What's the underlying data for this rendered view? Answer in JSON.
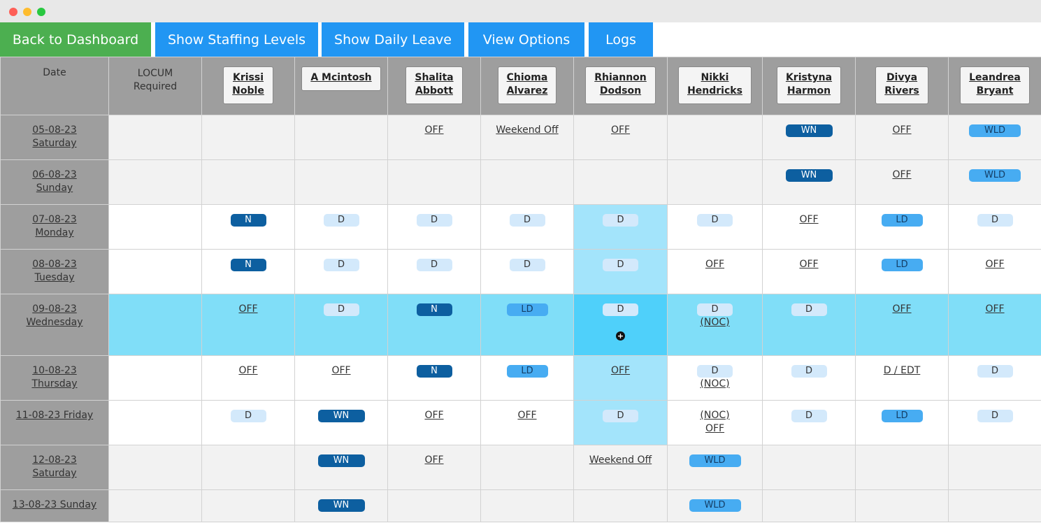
{
  "toolbar": {
    "back": "Back to Dashboard",
    "staffing": "Show Staffing Levels",
    "leave": "Show Daily Leave",
    "options": "View Options",
    "logs": "Logs"
  },
  "header": {
    "date": "Date",
    "locum_line1": "LOCUM",
    "locum_line2": "Required"
  },
  "staff": [
    {
      "first": "Krissi",
      "last": "Noble"
    },
    {
      "first": "A Mcintosh",
      "last": ""
    },
    {
      "first": "Shalita",
      "last": "Abbott"
    },
    {
      "first": "Chioma",
      "last": "Alvarez"
    },
    {
      "first": "Rhiannon",
      "last": "Dodson"
    },
    {
      "first": "Nikki",
      "last": "Hendricks"
    },
    {
      "first": "Kristyna",
      "last": "Harmon"
    },
    {
      "first": "Divya",
      "last": "Rivers"
    },
    {
      "first": "Leandrea",
      "last": "Bryant"
    }
  ],
  "rows": [
    {
      "date1": "05-08-23",
      "date2": "Saturday",
      "type": "we",
      "cells": [
        "",
        "",
        "OFF",
        "Weekend Off",
        "OFF",
        "",
        "WN",
        "OFF",
        "WLD"
      ]
    },
    {
      "date1": "06-08-23",
      "date2": "Sunday",
      "type": "we",
      "cells": [
        "",
        "",
        "",
        "",
        "",
        "",
        "WN",
        "OFF",
        "WLD"
      ]
    },
    {
      "date1": "07-08-23",
      "date2": "Monday",
      "type": "wk",
      "cells": [
        "N",
        "D",
        "D",
        "D",
        "D",
        "D",
        "OFF",
        "LD",
        "D"
      ]
    },
    {
      "date1": "08-08-23",
      "date2": "Tuesday",
      "type": "wk",
      "cells": [
        "N",
        "D",
        "D",
        "D",
        "D",
        "OFF",
        "OFF",
        "LD",
        "OFF"
      ]
    },
    {
      "date1": "09-08-23",
      "date2": "Wednesday",
      "type": "today",
      "cells": [
        "OFF",
        "D",
        "N",
        "LD",
        "D",
        "D|(NOC)",
        "D",
        "OFF",
        "OFF"
      ]
    },
    {
      "date1": "10-08-23",
      "date2": "Thursday",
      "type": "wk",
      "cells": [
        "OFF",
        "OFF",
        "N",
        "LD",
        "OFF",
        "D|(NOC)",
        "D",
        "D / EDT",
        "D"
      ]
    },
    {
      "date1": "11-08-23 Friday",
      "date2": "",
      "type": "wk",
      "cells": [
        "D",
        "WN",
        "OFF",
        "OFF",
        "D",
        "(NOC)|OFF",
        "D",
        "LD",
        "D"
      ]
    },
    {
      "date1": "12-08-23",
      "date2": "Saturday",
      "type": "we",
      "cells": [
        "",
        "WN",
        "OFF",
        "",
        "Weekend Off",
        "WLD",
        "",
        "",
        ""
      ]
    },
    {
      "date1": "13-08-23 Sunday",
      "date2": "",
      "type": "we",
      "cells": [
        "",
        "WN",
        "",
        "",
        "",
        "WLD",
        "",
        "",
        ""
      ]
    }
  ],
  "colors": {
    "back_button": "#4caf50",
    "nav_button": "#2196f3",
    "header_bg": "#9e9e9e",
    "today_row": "#80def8",
    "selected_column": "#a3e4fb",
    "dark_pill": "#0d5fa0",
    "light_pill": "#d3e9fb",
    "mid_pill": "#47acf2"
  },
  "icons": {
    "add": "plus-circle-icon"
  }
}
